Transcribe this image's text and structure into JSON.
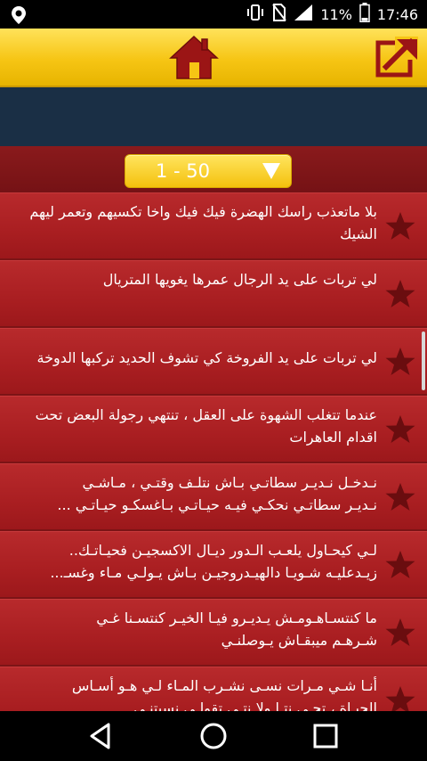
{
  "status_bar": {
    "battery_percent": "11%",
    "time": "17:46",
    "icons": [
      "location-pin-icon",
      "vibrate-icon",
      "no-sim-icon",
      "signal-icon",
      "battery-icon"
    ]
  },
  "header": {
    "home_icon": "home-icon",
    "share_icon": "share-out-icon",
    "colors": {
      "header_yellow": "#f6c514",
      "icon_red": "#9b1515"
    }
  },
  "range_selector": {
    "label": "1 - 50",
    "arrow_icon": "triangle-down-icon"
  },
  "list": {
    "star_icon": "star-icon",
    "items": [
      {
        "text": "بلا ماتعذب راسك الهضرة فيك فيك واخا تكسيهم وتعمر ليهم\nالشيك"
      },
      {
        "text": "لي تربات على يد الرجال عمرها يغويها المتريال"
      },
      {
        "text": "لي تربات على يد الفروخة كي تشوف الحديد تركبها الدوخة"
      },
      {
        "text": "عندما تتغلب الشهوة على العقل ، تنتهي رجولة البعض تحت\nاقدام العاهرات"
      },
      {
        "text": "نـدخـل نـديـر سطاتـي بـاش نتلـف وقتـي ، مـاشـي\nنـديـر سطاتـي نحكـي فيـه حيـاتـي بـاغسكـو حيـاتـي ..."
      },
      {
        "text": "لـي كيحـاول يلعـب الـدور ديـال الاكسجيـن فحيـاتـك..\nزيـدعليـه شـويـا دالهيـدروجيـن بـاش يـولـي مـاء وغسـ..."
      },
      {
        "text": "ما كنتسـاهـومـش يـديـرو فيـا الخيـر كنتسـنا غـي\nشـرهـم ميبقـاش يـوصلنـي"
      },
      {
        "text": "أنـا شـي مـرات نسـى نشـرب المـاء لـي هـو أسـاس\nالحيـاة ، تجـي نتـا ولا نتـي تقولـي نسيتنـي"
      }
    ]
  },
  "nav_bar": {
    "back_icon": "back-triangle-icon",
    "home_icon": "home-circle-icon",
    "recents_icon": "recents-square-icon"
  }
}
